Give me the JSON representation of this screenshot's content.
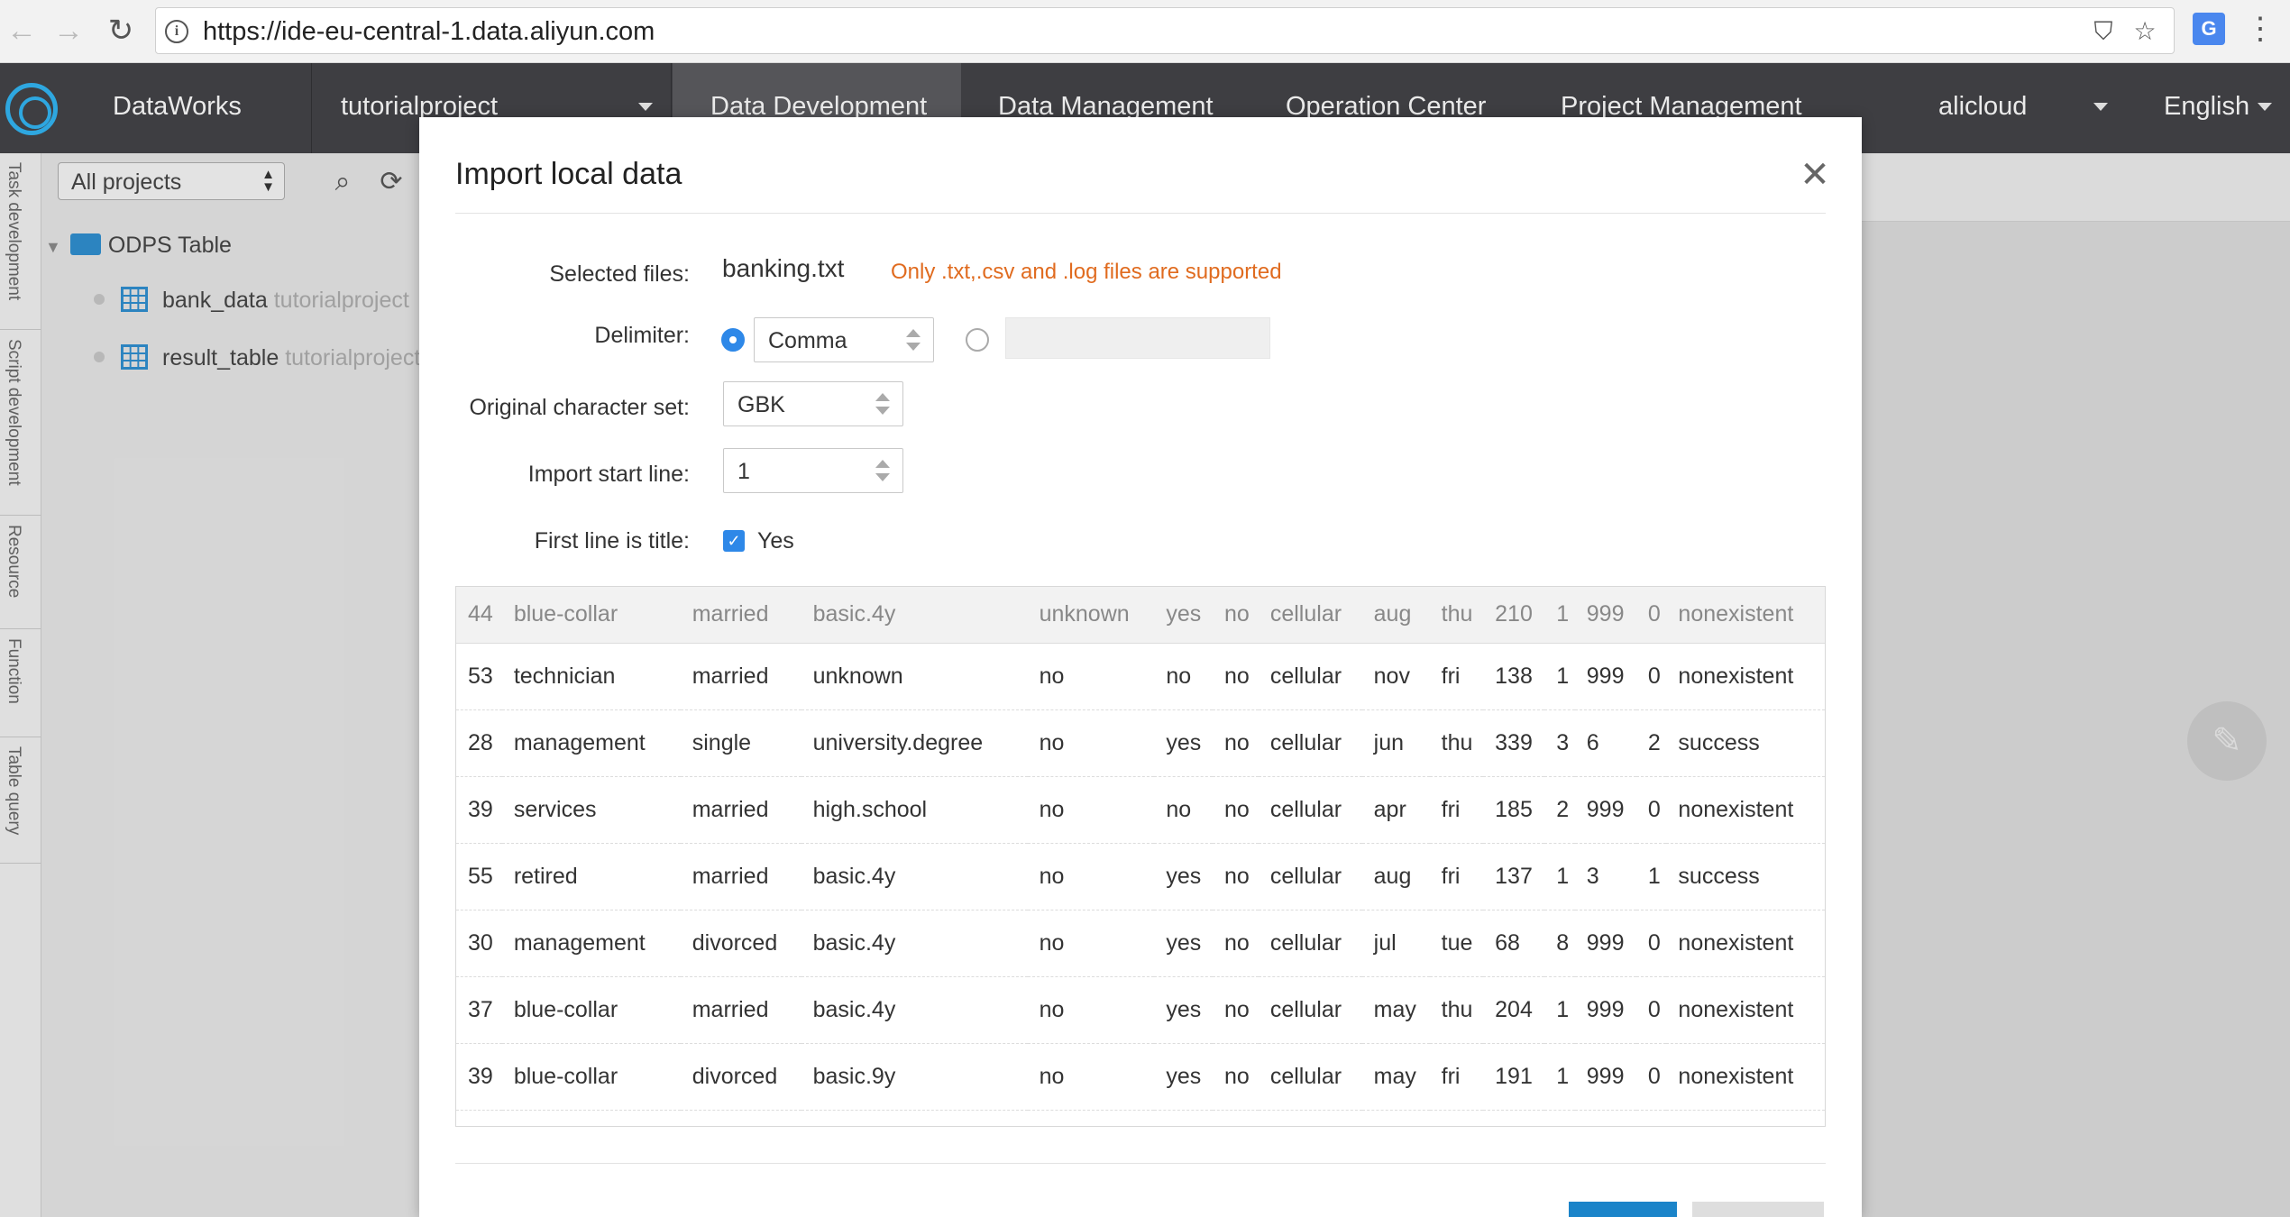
{
  "browser": {
    "url": "https://ide-eu-central-1.data.aliyun.com"
  },
  "appbar": {
    "brand": "DataWorks",
    "project": "tutorialproject",
    "nav": [
      "Data Development",
      "Data Management",
      "Operation Center",
      "Project Management"
    ],
    "account": "alicloud",
    "language": "English"
  },
  "vertical_tabs": [
    "Task development",
    "Script development",
    "Resource",
    "Function",
    "Table query"
  ],
  "tree": {
    "filter": "All projects",
    "root": "ODPS Table",
    "tables": [
      {
        "name": "bank_data",
        "project": "tutorialproject"
      },
      {
        "name": "result_table",
        "project": "tutorialproject"
      }
    ]
  },
  "dialog": {
    "title": "Import local data",
    "selected_files_label": "Selected files:",
    "selected_file": "banking.txt",
    "support_hint": "Only .txt,.csv and .log files are supported",
    "delimiter_label": "Delimiter:",
    "delimiter_value": "Comma",
    "charset_label": "Original character set:",
    "charset_value": "GBK",
    "start_line_label": "Import start line:",
    "start_line_value": "1",
    "first_line_label": "First line is title:",
    "first_line_option": "Yes",
    "preview": {
      "header": [
        "44",
        "blue-collar",
        "married",
        "basic.4y",
        "unknown",
        "yes",
        "no",
        "cellular",
        "aug",
        "thu",
        "210",
        "1",
        "999",
        "0",
        "nonexistent"
      ],
      "rows": [
        [
          "53",
          "technician",
          "married",
          "unknown",
          "no",
          "no",
          "no",
          "cellular",
          "nov",
          "fri",
          "138",
          "1",
          "999",
          "0",
          "nonexistent"
        ],
        [
          "28",
          "management",
          "single",
          "university.degree",
          "no",
          "yes",
          "no",
          "cellular",
          "jun",
          "thu",
          "339",
          "3",
          "6",
          "2",
          "success"
        ],
        [
          "39",
          "services",
          "married",
          "high.school",
          "no",
          "no",
          "no",
          "cellular",
          "apr",
          "fri",
          "185",
          "2",
          "999",
          "0",
          "nonexistent"
        ],
        [
          "55",
          "retired",
          "married",
          "basic.4y",
          "no",
          "yes",
          "no",
          "cellular",
          "aug",
          "fri",
          "137",
          "1",
          "3",
          "1",
          "success"
        ],
        [
          "30",
          "management",
          "divorced",
          "basic.4y",
          "no",
          "yes",
          "no",
          "cellular",
          "jul",
          "tue",
          "68",
          "8",
          "999",
          "0",
          "nonexistent"
        ],
        [
          "37",
          "blue-collar",
          "married",
          "basic.4y",
          "no",
          "yes",
          "no",
          "cellular",
          "may",
          "thu",
          "204",
          "1",
          "999",
          "0",
          "nonexistent"
        ],
        [
          "39",
          "blue-collar",
          "divorced",
          "basic.9y",
          "no",
          "yes",
          "no",
          "cellular",
          "may",
          "fri",
          "191",
          "1",
          "999",
          "0",
          "nonexistent"
        ]
      ]
    }
  }
}
